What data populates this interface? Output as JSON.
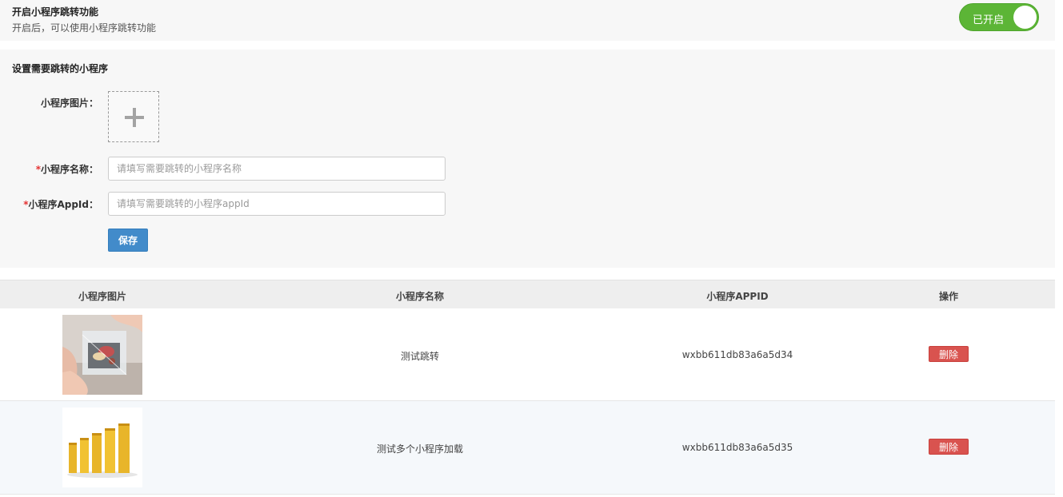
{
  "header": {
    "title": "开启小程序跳转功能",
    "description": "开启后，可以使用小程序跳转功能",
    "toggle_label": "已开启"
  },
  "form": {
    "title": "设置需要跳转的小程序",
    "image_label": "小程序图片：",
    "name_label": "小程序名称：",
    "name_placeholder": "请填写需要跳转的小程序名称",
    "name_value": "",
    "appid_label": "小程序AppId：",
    "appid_placeholder": "请填写需要跳转的小程序appId",
    "appid_value": "",
    "required_mark": "*",
    "save_label": "保存"
  },
  "table": {
    "columns": [
      "小程序图片",
      "小程序名称",
      "小程序APPID",
      "操作"
    ],
    "rows": [
      {
        "image": "plastic-wrap-photo",
        "name": "测试跳转",
        "appid": "wxbb611db83a6a5d34",
        "action": "删除"
      },
      {
        "image": "wrap-rolls-photo",
        "name": "测试多个小程序加载",
        "appid": "wxbb611db83a6a5d35",
        "action": "删除"
      }
    ]
  },
  "colors": {
    "toggle_on": "#5cb536",
    "primary": "#428bca",
    "danger": "#d9534f",
    "required": "#e53333"
  }
}
